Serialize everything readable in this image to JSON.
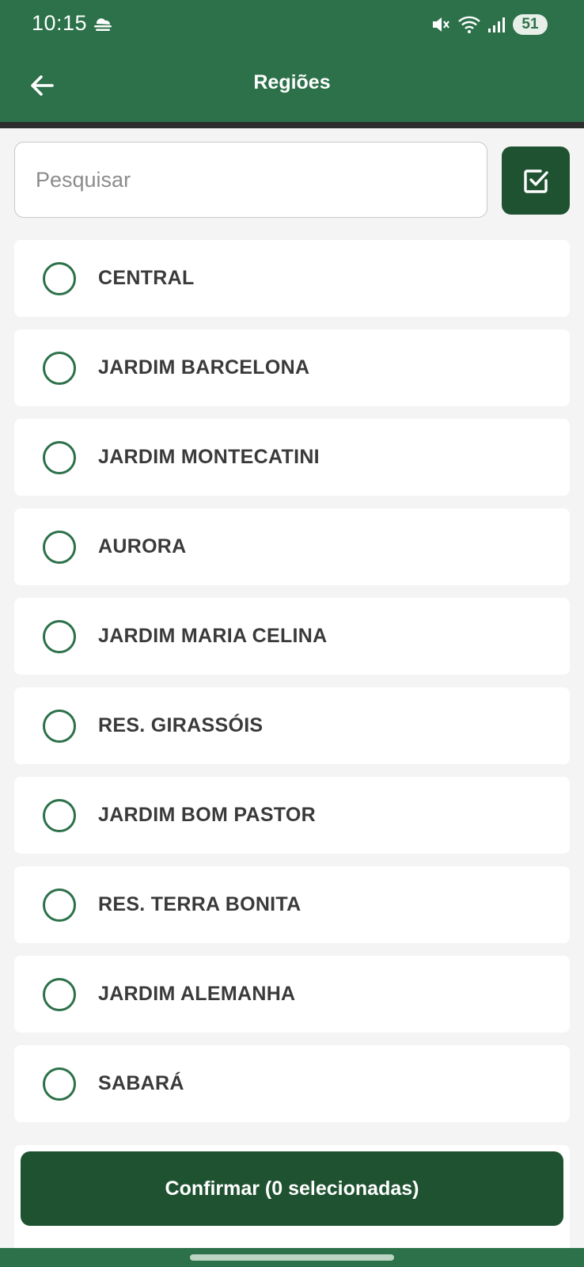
{
  "status_bar": {
    "time": "10:15",
    "weather_icon": "cloud-fog-icon",
    "battery": "51"
  },
  "app_bar": {
    "title": "Regiões",
    "back_icon": "arrow-left-icon"
  },
  "search": {
    "placeholder": "Pesquisar",
    "value": "",
    "select_all_icon": "checkbox-icon"
  },
  "regions": [
    {
      "label": "CENTRAL",
      "selected": false
    },
    {
      "label": "JARDIM BARCELONA",
      "selected": false
    },
    {
      "label": "JARDIM MONTECATINI",
      "selected": false
    },
    {
      "label": "AURORA",
      "selected": false
    },
    {
      "label": "JARDIM MARIA CELINA",
      "selected": false
    },
    {
      "label": "RES. GIRASSÓIS",
      "selected": false
    },
    {
      "label": "JARDIM BOM PASTOR",
      "selected": false
    },
    {
      "label": "RES. TERRA BONITA",
      "selected": false
    },
    {
      "label": "JARDIM ALEMANHA",
      "selected": false
    },
    {
      "label": "SABARÁ",
      "selected": false
    }
  ],
  "confirm": {
    "label": "Confirmar (0 selecionadas)"
  },
  "colors": {
    "primary": "#2c7149",
    "primary_dark": "#1f5230",
    "background": "#f4f4f4",
    "text": "#3a3a3a"
  }
}
